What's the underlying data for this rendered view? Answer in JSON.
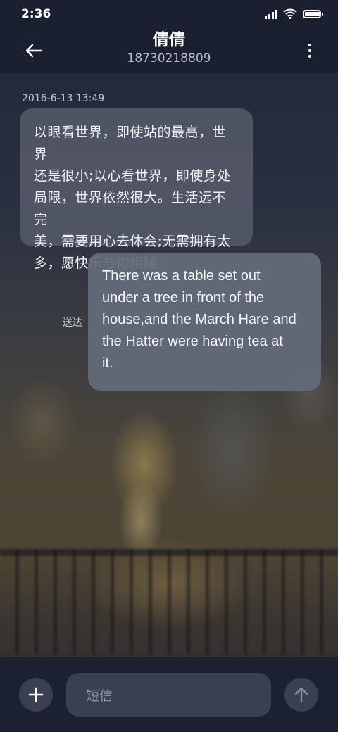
{
  "status_bar": {
    "time": "2:36",
    "battery_level": 1.0,
    "signal_bars": 4
  },
  "header": {
    "contact_name": "倩倩",
    "contact_phone": "18730218809",
    "back_icon": "arrow-left-icon",
    "more_icon": "more-vertical-icon"
  },
  "conversation": {
    "timestamp": "2016-6-13 13:49",
    "messages": [
      {
        "direction": "incoming",
        "lines": [
          "以眼看世界，即使站的最高，世界",
          "还是很小;以心看世界，即使身处",
          "局限，世界依然很大。生活远不完",
          "美，需要用心去体会;无需拥有太",
          "多，愿快乐与你相随。"
        ]
      },
      {
        "direction": "outgoing",
        "status": "送达",
        "lines": [
          "There was a table set out",
          "under a tree in front of the",
          "house,and the March Hare and",
          "the Hatter were having tea at",
          "it."
        ]
      }
    ]
  },
  "composer": {
    "placeholder": "短信",
    "add_icon": "plus-icon",
    "send_icon": "arrow-up-icon"
  },
  "colors": {
    "header_bg": "#1b2030",
    "incoming_bubble": "#555a69",
    "outgoing_bubble": "#646b7a",
    "composer_bg": "#3a4051"
  }
}
